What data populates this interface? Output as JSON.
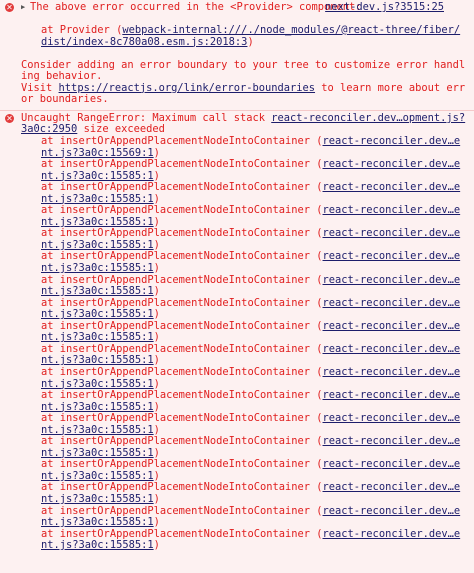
{
  "message1": {
    "header": "The above error occurred in the <Provider> component:",
    "source_link": "next-dev.js?3515:25",
    "at_prefix": "at Provider (",
    "at_link": "webpack-internal:///./node_modules/@react-three/fiber/dist/index-8c780a08.esm.js:2018:3",
    "at_suffix": ")",
    "advice": "Consider adding an error boundary to your tree to customize error handling behavior.",
    "visit_prefix": "Visit ",
    "visit_link": "https://reactjs.org/link/error-boundaries",
    "visit_suffix": " to learn more about error boundaries."
  },
  "message2": {
    "header_prefix": "Uncaught RangeError: Maximum call stack ",
    "header_link": "react-reconciler.dev…opment.js?3a0c:2950",
    "header_suffix": " size exceeded",
    "frames": [
      {
        "fn": "at insertOrAppendPlacementNodeIntoContainer (",
        "link": "react-reconciler.dev…ent.js?3a0c:15569:1",
        "suffix": ")"
      },
      {
        "fn": "at insertOrAppendPlacementNodeIntoContainer (",
        "link": "react-reconciler.dev…ent.js?3a0c:15585:1",
        "suffix": ")"
      },
      {
        "fn": "at insertOrAppendPlacementNodeIntoContainer (",
        "link": "react-reconciler.dev…ent.js?3a0c:15585:1",
        "suffix": ")"
      },
      {
        "fn": "at insertOrAppendPlacementNodeIntoContainer (",
        "link": "react-reconciler.dev…ent.js?3a0c:15585:1",
        "suffix": ")"
      },
      {
        "fn": "at insertOrAppendPlacementNodeIntoContainer (",
        "link": "react-reconciler.dev…ent.js?3a0c:15585:1",
        "suffix": ")"
      },
      {
        "fn": "at insertOrAppendPlacementNodeIntoContainer (",
        "link": "react-reconciler.dev…ent.js?3a0c:15585:1",
        "suffix": ")"
      },
      {
        "fn": "at insertOrAppendPlacementNodeIntoContainer (",
        "link": "react-reconciler.dev…ent.js?3a0c:15585:1",
        "suffix": ")"
      },
      {
        "fn": "at insertOrAppendPlacementNodeIntoContainer (",
        "link": "react-reconciler.dev…ent.js?3a0c:15585:1",
        "suffix": ")"
      },
      {
        "fn": "at insertOrAppendPlacementNodeIntoContainer (",
        "link": "react-reconciler.dev…ent.js?3a0c:15585:1",
        "suffix": ")"
      },
      {
        "fn": "at insertOrAppendPlacementNodeIntoContainer (",
        "link": "react-reconciler.dev…ent.js?3a0c:15585:1",
        "suffix": ")"
      },
      {
        "fn": "at insertOrAppendPlacementNodeIntoContainer (",
        "link": "react-reconciler.dev…ent.js?3a0c:15585:1",
        "suffix": ")"
      },
      {
        "fn": "at insertOrAppendPlacementNodeIntoContainer (",
        "link": "react-reconciler.dev…ent.js?3a0c:15585:1",
        "suffix": ")"
      },
      {
        "fn": "at insertOrAppendPlacementNodeIntoContainer (",
        "link": "react-reconciler.dev…ent.js?3a0c:15585:1",
        "suffix": ")"
      },
      {
        "fn": "at insertOrAppendPlacementNodeIntoContainer (",
        "link": "react-reconciler.dev…ent.js?3a0c:15585:1",
        "suffix": ")"
      },
      {
        "fn": "at insertOrAppendPlacementNodeIntoContainer (",
        "link": "react-reconciler.dev…ent.js?3a0c:15585:1",
        "suffix": ")"
      },
      {
        "fn": "at insertOrAppendPlacementNodeIntoContainer (",
        "link": "react-reconciler.dev…ent.js?3a0c:15585:1",
        "suffix": ")"
      },
      {
        "fn": "at insertOrAppendPlacementNodeIntoContainer (",
        "link": "react-reconciler.dev…ent.js?3a0c:15585:1",
        "suffix": ")"
      },
      {
        "fn": "at insertOrAppendPlacementNodeIntoContainer (",
        "link": "react-reconciler.dev…ent.js?3a0c:15585:1",
        "suffix": ")"
      }
    ]
  }
}
